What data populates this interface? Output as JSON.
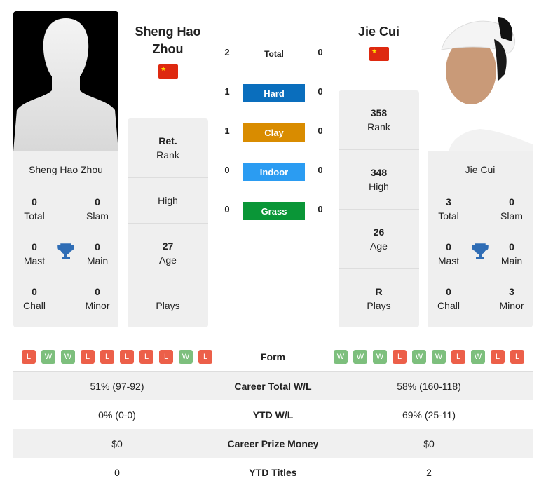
{
  "player1": {
    "name": "Sheng Hao Zhou",
    "name_line1": "Sheng Hao",
    "name_line2": "Zhou",
    "flag": "china-flag",
    "stats": {
      "total": "0",
      "total_label": "Total",
      "slam": "0",
      "slam_label": "Slam",
      "mast": "0",
      "mast_label": "Mast",
      "main": "0",
      "main_label": "Main",
      "chall": "0",
      "chall_label": "Chall",
      "minor": "0",
      "minor_label": "Minor"
    },
    "card": [
      {
        "value": "Ret.",
        "label": "Rank"
      },
      {
        "value": "",
        "label": "High"
      },
      {
        "value": "27",
        "label": "Age"
      },
      {
        "value": "",
        "label": "Plays"
      }
    ],
    "form": [
      "L",
      "W",
      "W",
      "L",
      "L",
      "L",
      "L",
      "L",
      "W",
      "L"
    ]
  },
  "player2": {
    "name": "Jie Cui",
    "flag": "china-flag",
    "stats": {
      "total": "3",
      "total_label": "Total",
      "slam": "0",
      "slam_label": "Slam",
      "mast": "0",
      "mast_label": "Mast",
      "main": "0",
      "main_label": "Main",
      "chall": "0",
      "chall_label": "Chall",
      "minor": "3",
      "minor_label": "Minor"
    },
    "card": [
      {
        "value": "358",
        "label": "Rank"
      },
      {
        "value": "348",
        "label": "High"
      },
      {
        "value": "26",
        "label": "Age"
      },
      {
        "value": "R",
        "label": "Plays"
      }
    ],
    "form": [
      "W",
      "W",
      "W",
      "L",
      "W",
      "W",
      "L",
      "W",
      "L",
      "L"
    ]
  },
  "h2h": [
    {
      "label": "Total",
      "p1": "2",
      "p2": "0",
      "color": ""
    },
    {
      "label": "Hard",
      "p1": "1",
      "p2": "0",
      "color": "#0a6ebd"
    },
    {
      "label": "Clay",
      "p1": "1",
      "p2": "0",
      "color": "#d98c00"
    },
    {
      "label": "Indoor",
      "p1": "0",
      "p2": "0",
      "color": "#2b9cf2"
    },
    {
      "label": "Grass",
      "p1": "0",
      "p2": "0",
      "color": "#0a9637"
    }
  ],
  "table": {
    "form_label": "Form",
    "rows": [
      {
        "label": "Career Total W/L",
        "p1": "51% (97-92)",
        "p2": "58% (160-118)"
      },
      {
        "label": "YTD W/L",
        "p1": "0% (0-0)",
        "p2": "69% (25-11)"
      },
      {
        "label": "Career Prize Money",
        "p1": "$0",
        "p2": "$0"
      },
      {
        "label": "YTD Titles",
        "p1": "0",
        "p2": "2"
      }
    ]
  }
}
